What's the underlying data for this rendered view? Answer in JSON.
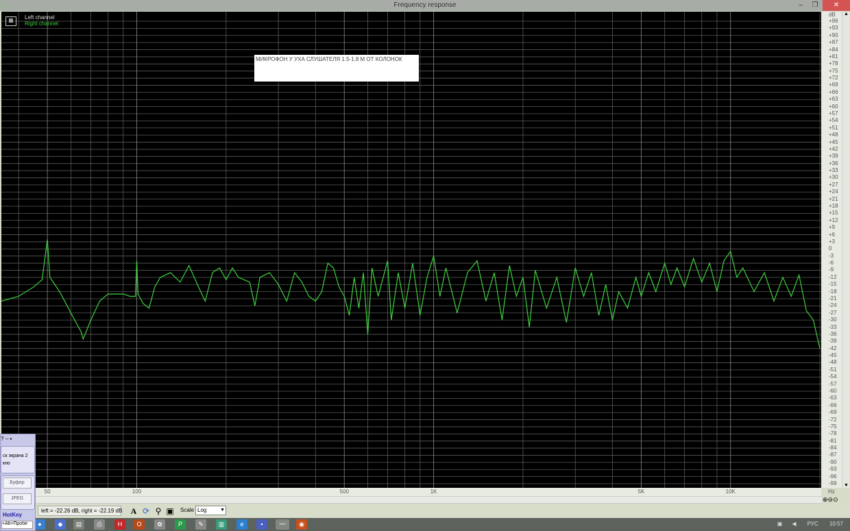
{
  "window": {
    "title": "Frequency response"
  },
  "legend": {
    "left": "Left channel",
    "right": "Right channel"
  },
  "annotation": "МИКРОФОН  У УХА СЛУШАТЕЛЯ 1.5-1.8 М ОТ КОЛОНОК",
  "colors": {
    "right_channel": "#3fd23f",
    "left_channel": "#ffffff",
    "grid": "#5a5a5a",
    "background": "#000000"
  },
  "chart_data": {
    "type": "line",
    "title": "Frequency response",
    "xlabel": "Hz",
    "ylabel": "dB",
    "xscale": "log",
    "xlim": [
      35,
      20200
    ],
    "ylim": [
      -99,
      96
    ],
    "x_ticks": [
      {
        "v": 50,
        "label": "50"
      },
      {
        "v": 100,
        "label": "100"
      },
      {
        "v": 500,
        "label": "500"
      },
      {
        "v": 1000,
        "label": "1K"
      },
      {
        "v": 5000,
        "label": "5K"
      },
      {
        "v": 10000,
        "label": "10K"
      }
    ],
    "y_tick_step": 3,
    "y_unit_label": "dB",
    "x_unit_label": "Hz",
    "grid": true,
    "legend_position": "top-left",
    "series": [
      {
        "name": "Right channel",
        "points": [
          [
            35,
            -22
          ],
          [
            40,
            -20
          ],
          [
            45,
            -16
          ],
          [
            48,
            -13
          ],
          [
            50,
            4
          ],
          [
            51,
            -12
          ],
          [
            55,
            -18
          ],
          [
            60,
            -27
          ],
          [
            65,
            -35
          ],
          [
            66,
            -38
          ],
          [
            70,
            -30
          ],
          [
            75,
            -22
          ],
          [
            80,
            -19
          ],
          [
            90,
            -19
          ],
          [
            95,
            -20
          ],
          [
            99,
            -20
          ],
          [
            100,
            -5
          ],
          [
            101,
            -19
          ],
          [
            105,
            -23
          ],
          [
            110,
            -25
          ],
          [
            115,
            -16
          ],
          [
            120,
            -12
          ],
          [
            130,
            -10
          ],
          [
            140,
            -14
          ],
          [
            150,
            -7
          ],
          [
            160,
            -15
          ],
          [
            170,
            -22
          ],
          [
            180,
            -10
          ],
          [
            190,
            -8
          ],
          [
            200,
            -13
          ],
          [
            210,
            -8
          ],
          [
            220,
            -12
          ],
          [
            240,
            -14
          ],
          [
            250,
            -24
          ],
          [
            260,
            -12
          ],
          [
            280,
            -10
          ],
          [
            300,
            -15
          ],
          [
            320,
            -22
          ],
          [
            340,
            -10
          ],
          [
            360,
            -14
          ],
          [
            380,
            -20
          ],
          [
            400,
            -22
          ],
          [
            420,
            -18
          ],
          [
            440,
            -6
          ],
          [
            460,
            -8
          ],
          [
            480,
            -16
          ],
          [
            500,
            -20
          ],
          [
            520,
            -28
          ],
          [
            540,
            -12
          ],
          [
            560,
            -25
          ],
          [
            580,
            -10
          ],
          [
            600,
            -36
          ],
          [
            620,
            -8
          ],
          [
            650,
            -20
          ],
          [
            700,
            -5
          ],
          [
            720,
            -30
          ],
          [
            760,
            -10
          ],
          [
            800,
            -25
          ],
          [
            850,
            -6
          ],
          [
            900,
            -28
          ],
          [
            950,
            -12
          ],
          [
            1000,
            -3
          ],
          [
            1050,
            -20
          ],
          [
            1100,
            -8
          ],
          [
            1200,
            -27
          ],
          [
            1300,
            -10
          ],
          [
            1400,
            -5
          ],
          [
            1500,
            -22
          ],
          [
            1600,
            -10
          ],
          [
            1700,
            -30
          ],
          [
            1800,
            -7
          ],
          [
            1900,
            -20
          ],
          [
            2000,
            -12
          ],
          [
            2100,
            -33
          ],
          [
            2200,
            -9
          ],
          [
            2400,
            -25
          ],
          [
            2600,
            -12
          ],
          [
            2800,
            -31
          ],
          [
            3000,
            -8
          ],
          [
            3200,
            -20
          ],
          [
            3400,
            -10
          ],
          [
            3600,
            -28
          ],
          [
            3800,
            -15
          ],
          [
            4000,
            -30
          ],
          [
            4200,
            -18
          ],
          [
            4500,
            -25
          ],
          [
            4800,
            -12
          ],
          [
            5000,
            -20
          ],
          [
            5300,
            -10
          ],
          [
            5600,
            -18
          ],
          [
            6000,
            -6
          ],
          [
            6300,
            -15
          ],
          [
            6600,
            -8
          ],
          [
            7000,
            -16
          ],
          [
            7500,
            -4
          ],
          [
            8000,
            -14
          ],
          [
            8500,
            -6
          ],
          [
            9000,
            -18
          ],
          [
            9500,
            -5
          ],
          [
            10000,
            -1
          ],
          [
            10500,
            -12
          ],
          [
            11000,
            -8
          ],
          [
            12000,
            -18
          ],
          [
            13000,
            -10
          ],
          [
            14000,
            -22
          ],
          [
            15000,
            -12
          ],
          [
            16000,
            -20
          ],
          [
            17000,
            -11
          ],
          [
            18000,
            -26
          ],
          [
            19000,
            -30
          ],
          [
            20000,
            -42
          ]
        ]
      }
    ]
  },
  "status": "left = -22.26 dB, right = -22.19 dB",
  "toolbar": {
    "scale_label": "Scale",
    "scale_value": "Log"
  },
  "side_panel": {
    "line1": "ск экрана 2",
    "line2": "кно",
    "btn1": "Буфер",
    "btn2": "JPEG",
    "hotkey": "HotKey",
    "hotkey_value": "+Alt+Пробе"
  },
  "tray": {
    "lang": "РУС",
    "time": "10:57"
  }
}
